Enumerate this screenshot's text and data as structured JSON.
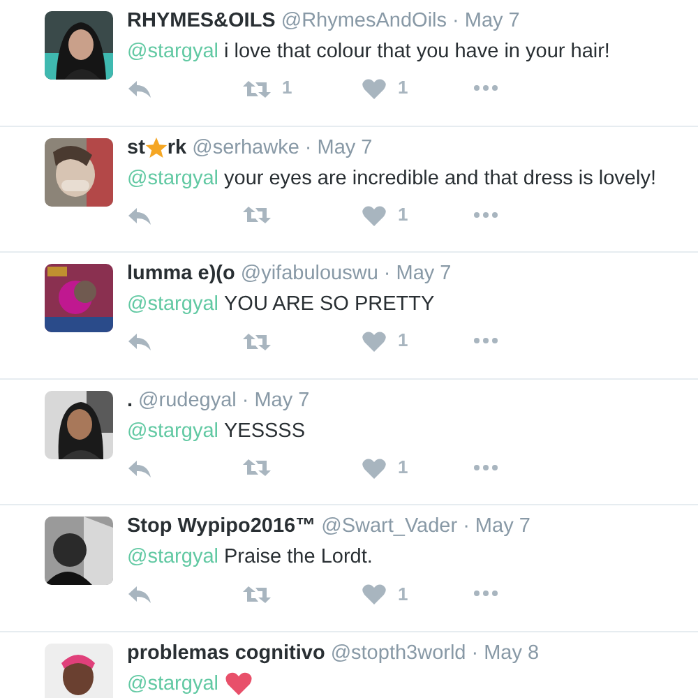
{
  "tweets": [
    {
      "name_parts": [
        {
          "kind": "text",
          "text": "RHYMES&OILS"
        }
      ],
      "handle": "@RhymesAndOils",
      "date": "· May 7",
      "mention": "@stargyal",
      "body": "i love that colour that you have in your hair!",
      "retweets": "1",
      "likes": "1"
    },
    {
      "name_parts": [
        {
          "kind": "text",
          "text": "st"
        },
        {
          "kind": "star"
        },
        {
          "kind": "text",
          "text": "rk"
        }
      ],
      "handle": "@serhawke",
      "date": "· May 7",
      "mention": "@stargyal",
      "body": "your eyes are incredible and that dress is lovely!",
      "likes": "1"
    },
    {
      "name_parts": [
        {
          "kind": "text",
          "text": "lumma e)(o"
        }
      ],
      "handle": "@yifabulouswu",
      "date": "· May 7",
      "mention": "@stargyal",
      "body": "YOU ARE SO PRETTY",
      "likes": "1"
    },
    {
      "name_parts": [
        {
          "kind": "text",
          "text": "."
        }
      ],
      "handle": "@rudegyal",
      "date": "· May 7",
      "mention": "@stargyal",
      "body": "YESSSS",
      "likes": "1"
    },
    {
      "name_parts": [
        {
          "kind": "text",
          "text": "Stop Wypipo2016™"
        }
      ],
      "handle": "@Swart_Vader",
      "date": "· May 7",
      "mention": "@stargyal",
      "body": "Praise the Lordt.",
      "likes": "1"
    },
    {
      "name_parts": [
        {
          "kind": "text",
          "text": "problemas cognitivo"
        }
      ],
      "handle": "@stopth3world",
      "date": "· May 8",
      "mention": "@stargyal",
      "body_parts": [
        {
          "kind": "heart"
        }
      ]
    }
  ]
}
